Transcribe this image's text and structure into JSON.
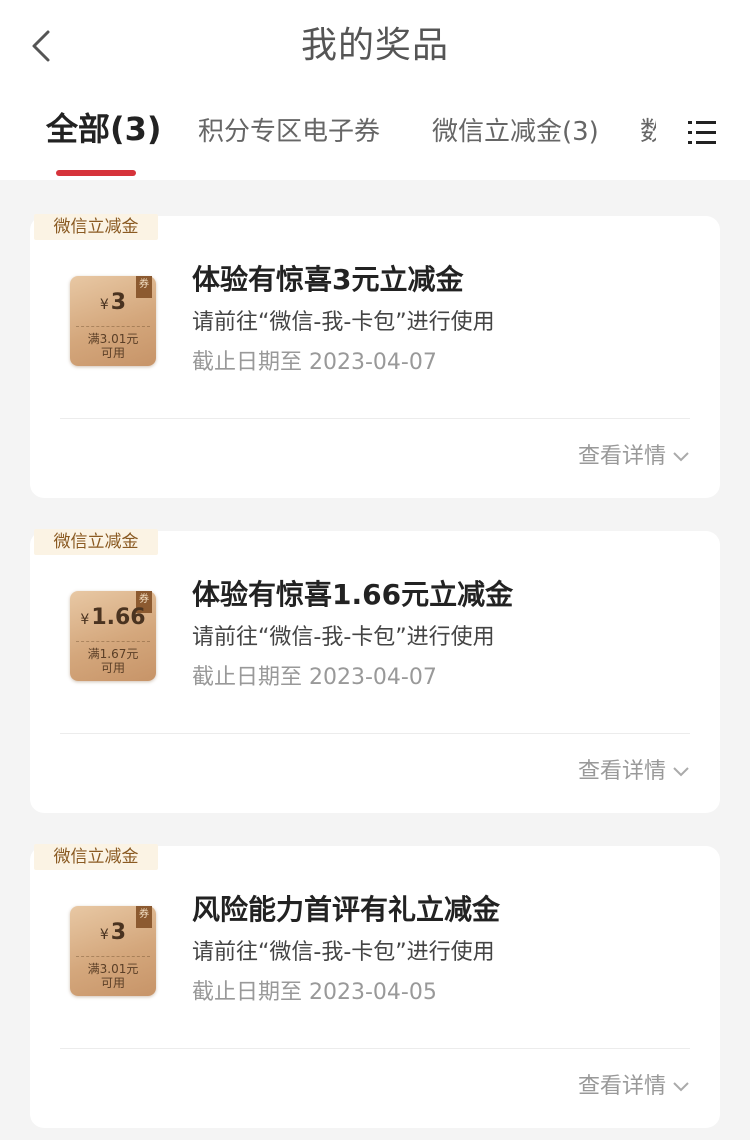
{
  "header": {
    "title": "我的奖品",
    "back_icon": "chevron-left-icon"
  },
  "tabs": [
    {
      "label": "全部(3)",
      "active": true
    },
    {
      "label": "积分专区电子券",
      "active": false
    },
    {
      "label": "微信立减金(3)",
      "active": false
    },
    {
      "label": "数",
      "active": false
    }
  ],
  "menu_icon": "list-menu-icon",
  "colors": {
    "accent": "#d6333b",
    "tag_bg": "#fbf3e4",
    "tag_text": "#8a5a22",
    "coupon": "#d4a77c"
  },
  "prizes": [
    {
      "tag": "微信立减金",
      "coupon_currency": "¥",
      "coupon_amount": "3",
      "coupon_condition_line1": "满3.01元",
      "coupon_condition_line2": "可用",
      "coupon_badge": "券",
      "title": "体验有惊喜3元立减金",
      "description": "请前往“微信-我-卡包”进行使用",
      "deadline": "截止日期至 2023-04-07",
      "detail_label": "查看详情"
    },
    {
      "tag": "微信立减金",
      "coupon_currency": "¥",
      "coupon_amount": "1.66",
      "coupon_condition_line1": "满1.67元",
      "coupon_condition_line2": "可用",
      "coupon_badge": "券",
      "title": "体验有惊喜1.66元立减金",
      "description": "请前往“微信-我-卡包”进行使用",
      "deadline": "截止日期至 2023-04-07",
      "detail_label": "查看详情"
    },
    {
      "tag": "微信立减金",
      "coupon_currency": "¥",
      "coupon_amount": "3",
      "coupon_condition_line1": "满3.01元",
      "coupon_condition_line2": "可用",
      "coupon_badge": "券",
      "title": "风险能力首评有礼立减金",
      "description": "请前往“微信-我-卡包”进行使用",
      "deadline": "截止日期至 2023-04-05",
      "detail_label": "查看详情"
    }
  ]
}
